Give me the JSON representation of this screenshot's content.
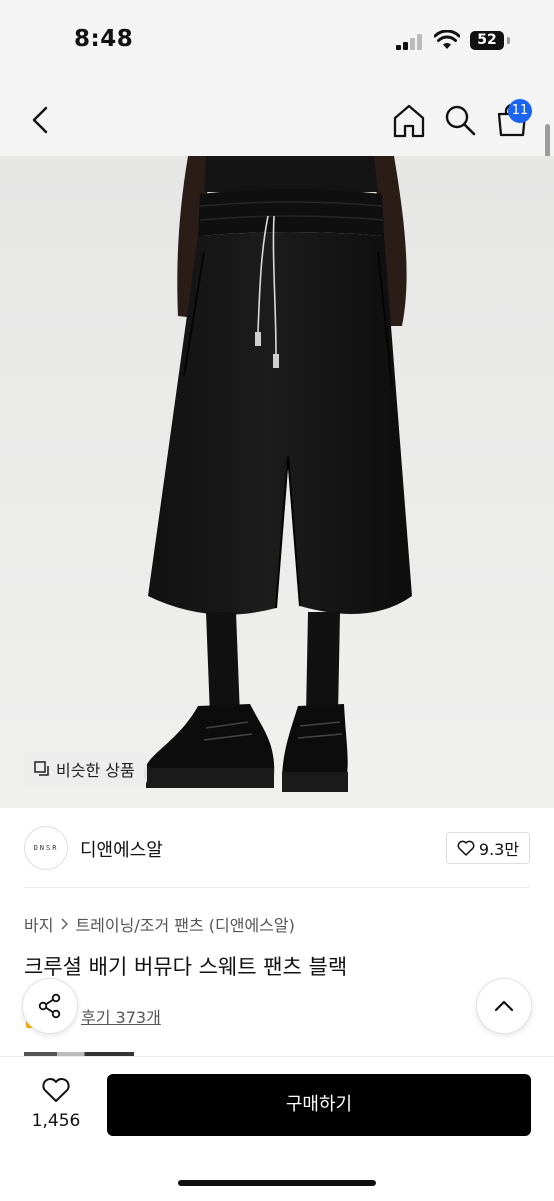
{
  "status_bar": {
    "time": "8:48",
    "battery": "52",
    "battery_level": 0.52,
    "icons": [
      "cellular-signal-icon",
      "wifi-icon",
      "battery-icon"
    ]
  },
  "nav": {
    "icons": [
      "back-arrow-icon",
      "home-icon",
      "search-icon",
      "cart-icon"
    ],
    "cart_badge": "11",
    "accent_color": "#1b64f0"
  },
  "image": {
    "similar_products_label": "비슷한 상품",
    "similar_icon": "copy-squares-icon"
  },
  "brand": {
    "logo_text": "DNSR",
    "name": "디앤에스알",
    "like_count": "9.3만",
    "like_icon": "heart-outline-icon"
  },
  "breadcrumb": {
    "items": [
      "바지",
      "트레이닝/조거 팬츠 (디앤에스알)"
    ],
    "separator_icon": "chevron-right-icon"
  },
  "product": {
    "title": "크루셜 배기 버뮤다 스웨트 팬츠 블랙",
    "review_link": "후기 373개"
  },
  "floating": {
    "share_icon": "share-icon",
    "scroll_top_icon": "chevron-up-icon"
  },
  "bottom_bar": {
    "wish_count": "1,456",
    "wish_icon": "heart-outline-icon",
    "buy_label": "구매하기",
    "buy_color": "#000000"
  }
}
